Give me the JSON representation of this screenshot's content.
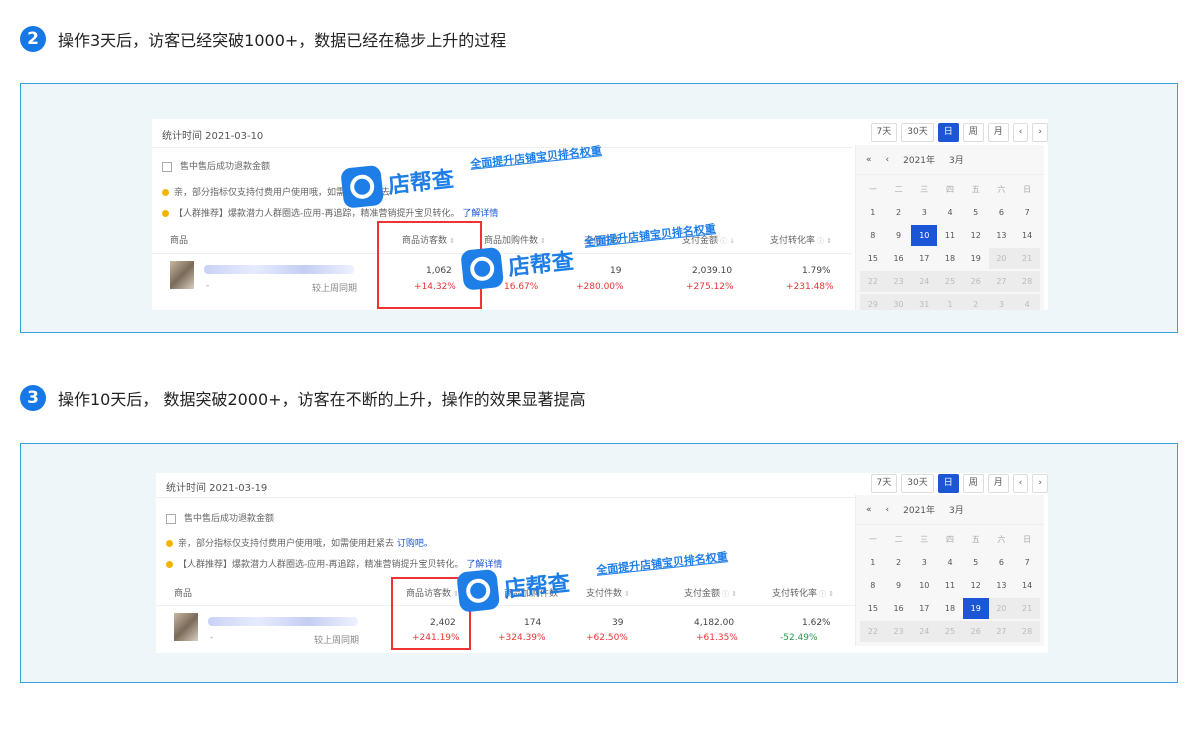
{
  "steps": [
    {
      "number": "2",
      "title": "操作3天后，访客已经突破1000+，数据已经在稳步上升的过程",
      "screenshot": {
        "stat_time": "统计时间 2021-03-10",
        "range_buttons": [
          "7天",
          "30天",
          "日",
          "周",
          "月"
        ],
        "active_range": "日",
        "checkbox_label": "售中售后成功退款金额",
        "notice1": "亲，部分指标仅支持付费用户使用哦，如需使用赶紧去",
        "notice2_prefix": "【人群推荐】爆款潜力人群圈选-应用-再追踪，精准营销提升宝贝转化。",
        "notice2_link": "了解详情",
        "columns": [
          "商品",
          "商品访客数",
          "商品加购件数",
          "支付件数",
          "支付金额",
          "支付转化率"
        ],
        "row": {
          "compare_label": "较上周同期",
          "values": [
            "1,062",
            "",
            "19",
            "2,039.10",
            "1.79%"
          ],
          "changes": [
            "+14.32%",
            "16.67%",
            "+280.00%",
            "+275.12%",
            "+231.48%"
          ]
        },
        "calendar": {
          "year": "2021年",
          "month": "3月",
          "weekdays": [
            "一",
            "二",
            "三",
            "四",
            "五",
            "六",
            "日"
          ],
          "days": [
            "1",
            "2",
            "3",
            "4",
            "5",
            "6",
            "7",
            "8",
            "9",
            "10",
            "11",
            "12",
            "13",
            "14",
            "15",
            "16",
            "17",
            "18",
            "19",
            "20",
            "21",
            "22",
            "23",
            "24",
            "25",
            "26",
            "27",
            "28",
            "29",
            "30",
            "31",
            "1",
            "2",
            "3",
            "4"
          ],
          "selected": "10",
          "first_dim": "20"
        },
        "watermark_brand": "店帮查",
        "watermark_slogan": "全面提升店铺宝贝排名权重"
      }
    },
    {
      "number": "3",
      "title": "操作10天后， 数据突破2000+，访客在不断的上升，操作的效果显著提高",
      "screenshot": {
        "stat_time": "统计时间 2021-03-19",
        "range_buttons": [
          "7天",
          "30天",
          "日",
          "周",
          "月"
        ],
        "active_range": "日",
        "checkbox_label": "售中售后成功退款金额",
        "notice1": "亲，部分指标仅支持付费用户使用哦，如需使用赶紧去",
        "notice1_link": "订购吧。",
        "notice2_prefix": "【人群推荐】爆款潜力人群圈选-应用-再追踪，精准营销提升宝贝转化。",
        "notice2_link": "了解详情",
        "columns": [
          "商品",
          "商品访客数",
          "商品加购件数",
          "支付件数",
          "支付金额",
          "支付转化率"
        ],
        "row": {
          "compare_label": "较上周同期",
          "values": [
            "2,402",
            "174",
            "39",
            "4,182.00",
            "1.62%"
          ],
          "changes": [
            "+241.19%",
            "+324.39%",
            "+62.50%",
            "+61.35%",
            "-52.49%"
          ]
        },
        "calendar": {
          "year": "2021年",
          "month": "3月",
          "weekdays": [
            "一",
            "二",
            "三",
            "四",
            "五",
            "六",
            "日"
          ],
          "days": [
            "1",
            "2",
            "3",
            "4",
            "5",
            "6",
            "7",
            "8",
            "9",
            "10",
            "11",
            "12",
            "13",
            "14",
            "15",
            "16",
            "17",
            "18",
            "19",
            "20",
            "21",
            "22",
            "23",
            "24",
            "25",
            "26",
            "27",
            "28"
          ],
          "selected": "19",
          "first_dim": "20"
        },
        "watermark_brand": "店帮查",
        "watermark_slogan": "全面提升店铺宝贝排名权重"
      }
    }
  ]
}
